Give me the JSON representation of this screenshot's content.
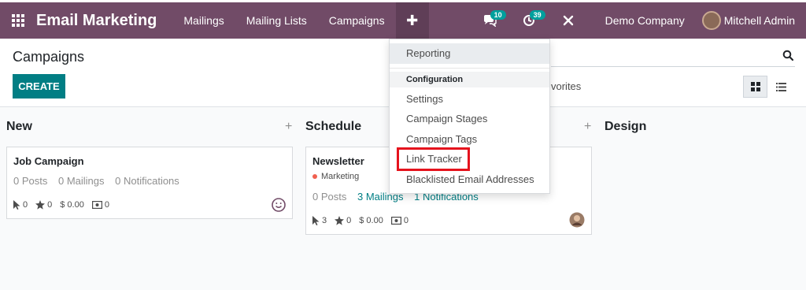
{
  "navbar": {
    "app_title": "Email Marketing",
    "menu": [
      "Mailings",
      "Mailing Lists",
      "Campaigns"
    ],
    "plus_label": "✚",
    "chat_count": "10",
    "activity_count": "39",
    "company": "Demo Company",
    "user": "Mitchell Admin"
  },
  "control_panel": {
    "breadcrumb": "Campaigns",
    "create_label": "CREATE",
    "favorites_label": "vorites"
  },
  "dropdown": {
    "reporting": "Reporting",
    "configuration_header": "Configuration",
    "items": [
      "Settings",
      "Campaign Stages",
      "Campaign Tags",
      "Link Tracker",
      "Blacklisted Email Addresses"
    ]
  },
  "columns": [
    {
      "title": "New",
      "add": "+"
    },
    {
      "title": "Schedule",
      "add": "+"
    },
    {
      "title": "Design",
      "add": ""
    }
  ],
  "cards": {
    "job": {
      "title": "Job Campaign",
      "posts": "0 Posts",
      "mailings": "0 Mailings",
      "notifications": "0 Notifications",
      "clicks": "0",
      "stars": "0",
      "revenue": "$ 0.00",
      "leads": "0"
    },
    "newsletter": {
      "title": "Newsletter",
      "tag": "Marketing",
      "posts": "0 Posts",
      "mailings": "3 Mailings",
      "notifications": "1 Notifications",
      "clicks": "3",
      "stars": "0",
      "revenue": "$ 0.00",
      "leads": "0"
    }
  },
  "colors": {
    "navbar": "#714b67",
    "primary": "#017e84",
    "badge": "#00a09d",
    "highlight": "#e5131d",
    "tag_dot": "#f06050"
  }
}
